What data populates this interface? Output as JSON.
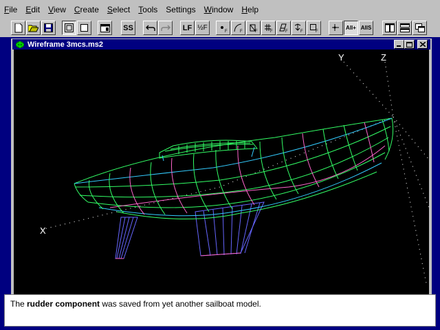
{
  "menu": [
    {
      "label": "File",
      "accel": "F",
      "rest": "ile"
    },
    {
      "label": "Edit",
      "accel": "E",
      "rest": "dit"
    },
    {
      "label": "View",
      "accel": "V",
      "rest": "iew"
    },
    {
      "label": "Create",
      "accel": "C",
      "rest": "reate"
    },
    {
      "label": "Select",
      "accel": "S",
      "rest": "elect"
    },
    {
      "label": "Tools",
      "accel": "T",
      "rest": "ools"
    },
    {
      "label": "Settings",
      "accel": "",
      "rest": "Settings"
    },
    {
      "label": "Window",
      "accel": "W",
      "rest": "indow"
    },
    {
      "label": "Help",
      "accel": "H",
      "rest": "elp"
    }
  ],
  "toolbar": {
    "buttons": [
      "new-icon",
      "open-icon",
      "save-icon",
      "frame-icon",
      "square-icon",
      "window-icon",
      "symmetry-icon",
      "undo-icon",
      "redo-icon",
      "line-icon",
      "fraction-icon",
      "point-icon",
      "curve-icon",
      "rotate-icon",
      "grid-icon",
      "surface-icon",
      "down-arrow-icon",
      "select-box-icon",
      "move-icon",
      "all-plus-icon",
      "all-s-icon",
      "tile-vertical-icon",
      "tile-horizontal-icon",
      "cascade-icon"
    ],
    "text_labels": {
      "line": "LF",
      "fraction": "½F",
      "symmetry": "SS",
      "all_plus": "All+",
      "all_s": "AllS"
    }
  },
  "window": {
    "title": "Wireframe 3mcs.ms2"
  },
  "axes": {
    "x": "X",
    "y": "Y",
    "z": "Z"
  },
  "caption": {
    "prefix": "The ",
    "bold": "rudder component",
    "suffix": " was saved from yet another sailboat model."
  },
  "colors": {
    "desktop": "#000080",
    "titlebar": "#000080",
    "viewport": "#000000",
    "wire_green": "#33ff66",
    "wire_cyan": "#33ccff",
    "wire_magenta": "#ff66cc",
    "wire_blue": "#6666ff"
  }
}
